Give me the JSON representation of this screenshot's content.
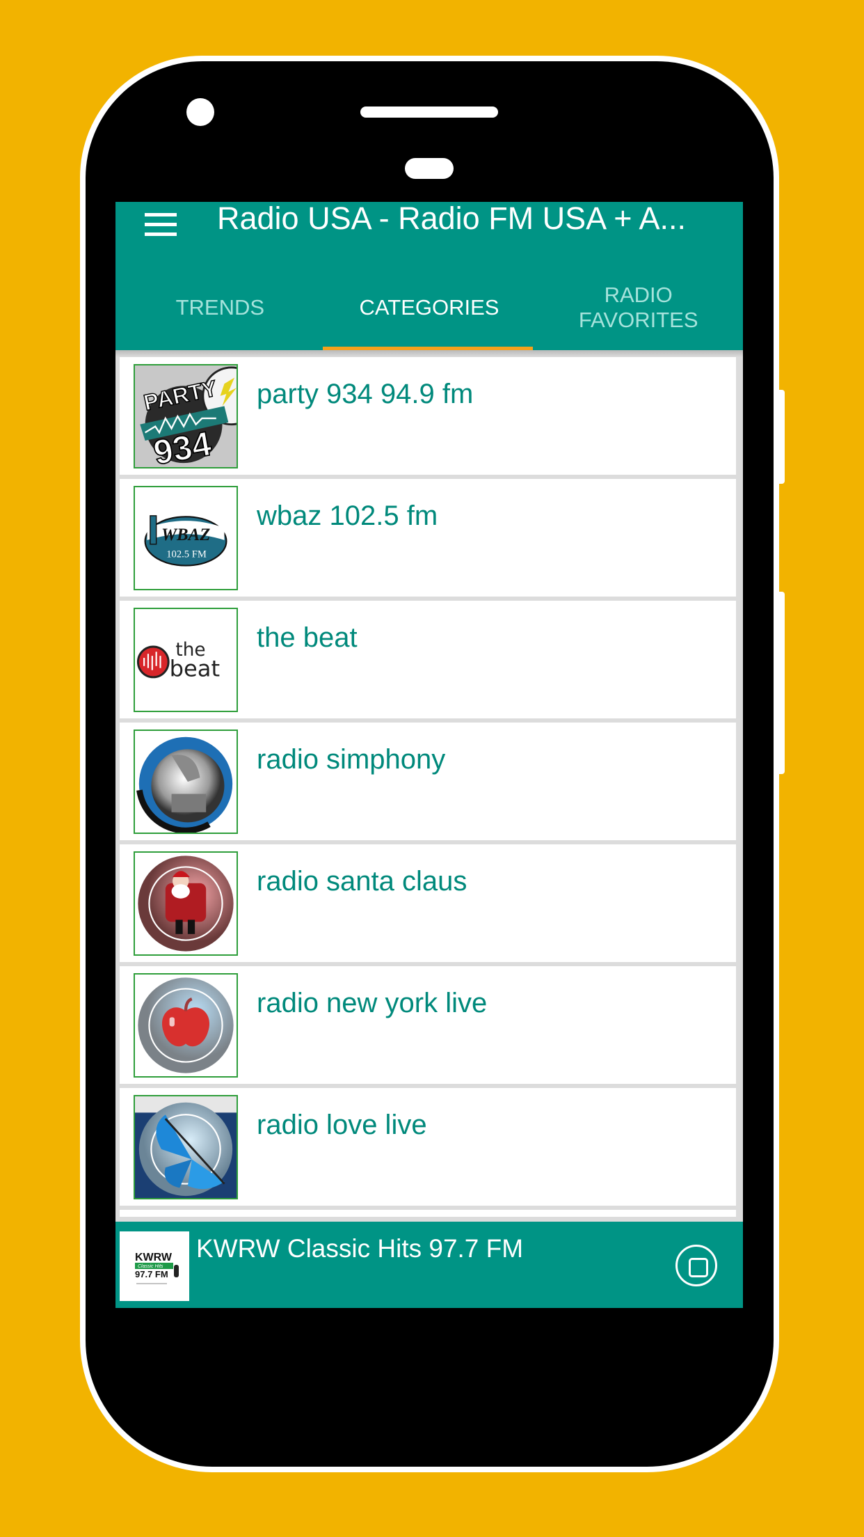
{
  "background_color": "#f2b300",
  "app": {
    "title": "Radio USA - Radio FM USA + A...",
    "menu_icon": "hamburger-menu-icon",
    "primary_color": "#009485",
    "accent_color": "#f5a11b"
  },
  "tabs": [
    {
      "label": "TRENDS",
      "active": false
    },
    {
      "label": "CATEGORIES",
      "active": true
    },
    {
      "label": "RADIO\nFAVORITES",
      "active": false
    }
  ],
  "stations": [
    {
      "name": "party 934 94.9 fm",
      "logo": "party-934-logo"
    },
    {
      "name": "wbaz 102.5 fm",
      "logo": "wbaz-logo"
    },
    {
      "name": "the beat",
      "logo": "the-beat-logo"
    },
    {
      "name": "radio simphony",
      "logo": "radio-symphony-logo"
    },
    {
      "name": "radio santa claus",
      "logo": "radio-santa-claus-logo"
    },
    {
      "name": "radio new york live",
      "logo": "radio-new-york-live-logo"
    },
    {
      "name": "radio love live",
      "logo": "radio-love-live-logo"
    }
  ],
  "logo_text": {
    "party": [
      "PARTY",
      "934"
    ],
    "wbaz": [
      "WBAZ",
      "102.5 FM"
    ],
    "beat": [
      "the",
      "beat"
    ],
    "kwrw": [
      "KWRW",
      "Classic Hits",
      "97.7 FM"
    ]
  },
  "player": {
    "now_playing": "KWRW Classic Hits 97.7 FM",
    "stop_icon": "stop-icon"
  }
}
